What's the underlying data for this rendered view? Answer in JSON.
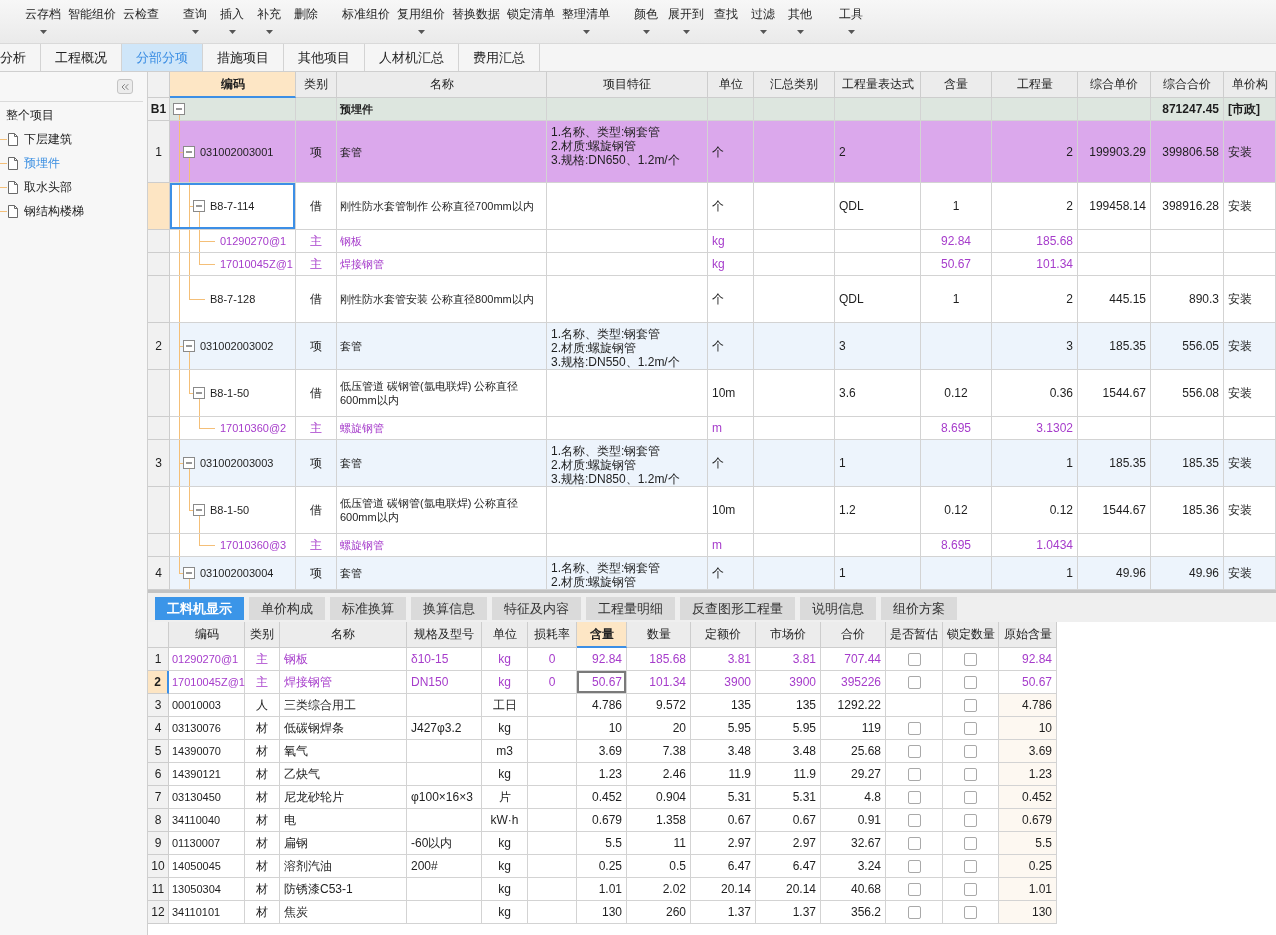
{
  "toolbar": {
    "groups": [
      [
        {
          "label": "云存档",
          "dropdown": true
        },
        {
          "label": "智能组价",
          "dropdown": false
        },
        {
          "label": "云检查",
          "dropdown": false
        }
      ],
      [
        {
          "label": "查询",
          "dropdown": true
        },
        {
          "label": "插入",
          "dropdown": true
        },
        {
          "label": "补充",
          "dropdown": true
        },
        {
          "label": "删除",
          "dropdown": false
        }
      ],
      [
        {
          "label": "标准组价",
          "dropdown": false
        },
        {
          "label": "复用组价",
          "dropdown": true
        },
        {
          "label": "替换数据",
          "dropdown": false
        },
        {
          "label": "锁定清单",
          "dropdown": false
        },
        {
          "label": "整理清单",
          "dropdown": true
        }
      ],
      [
        {
          "label": "颜色",
          "dropdown": true
        },
        {
          "label": "展开到",
          "dropdown": true
        },
        {
          "label": "查找",
          "dropdown": false
        },
        {
          "label": "过滤",
          "dropdown": true
        },
        {
          "label": "其他",
          "dropdown": true
        }
      ],
      [
        {
          "label": "工具",
          "dropdown": true
        }
      ]
    ]
  },
  "tabs": [
    {
      "label": "分析",
      "selected": false
    },
    {
      "label": "工程概况",
      "selected": false
    },
    {
      "label": "分部分项",
      "selected": true
    },
    {
      "label": "措施项目",
      "selected": false
    },
    {
      "label": "其他项目",
      "selected": false
    },
    {
      "label": "人材机汇总",
      "selected": false
    },
    {
      "label": "费用汇总",
      "selected": false
    }
  ],
  "sidebar": {
    "tree": [
      {
        "label": "整个项目",
        "selected": false,
        "children": [
          {
            "label": "下层建筑",
            "selected": false
          },
          {
            "label": "预埋件",
            "selected": true
          },
          {
            "label": "取水头部",
            "selected": false
          },
          {
            "label": "钢结构楼梯",
            "selected": false
          }
        ]
      }
    ]
  },
  "main_table": {
    "columns": [
      {
        "label": "编码",
        "selected": true
      },
      {
        "label": "类别",
        "selected": false
      },
      {
        "label": "名称",
        "selected": false
      },
      {
        "label": "项目特征",
        "selected": false
      },
      {
        "label": "单位",
        "selected": false
      },
      {
        "label": "汇总类别",
        "selected": false
      },
      {
        "label": "工程量表达式",
        "selected": false
      },
      {
        "label": "含量",
        "selected": false
      },
      {
        "label": "工程量",
        "selected": false
      },
      {
        "label": "综合单价",
        "selected": false
      },
      {
        "label": "综合合价",
        "selected": false
      },
      {
        "label": "单价构",
        "selected": false
      }
    ],
    "rows": [
      {
        "kind": "section",
        "number": "B1",
        "name": "预埋件",
        "total_price": "871247.45",
        "price_structure": "[市政]",
        "expanded": true,
        "selected": false,
        "children": [
          {
            "kind": "item",
            "number": "1",
            "code": "031002003001",
            "type": "项",
            "name": "套管",
            "features": "1.名称、类型:钢套管\n2.材质:螺旋钢管\n3.规格:DN650、1.2m/个",
            "unit": "个",
            "expression": "2",
            "quantity": "2",
            "unit_price": "199903.29",
            "total_price": "399806.58",
            "price_structure": "安装",
            "highlighted": true,
            "expanded": true,
            "selected": false,
            "children": [
              {
                "kind": "quota",
                "code": "B8-7-114",
                "type": "借",
                "name": "刚性防水套管制作 公称直径700mm以内",
                "unit": "个",
                "expression": "QDL",
                "content": "1",
                "quantity": "2",
                "unit_price": "199458.14",
                "total_price": "398916.28",
                "price_structure": "安装",
                "expanded": true,
                "selected": true,
                "children": [
                  {
                    "kind": "material",
                    "code": "01290270@1",
                    "type": "主",
                    "name": "钢板",
                    "unit": "kg",
                    "content": "92.84",
                    "quantity": "185.68",
                    "selected": false
                  },
                  {
                    "kind": "material",
                    "code": "17010045Z@1",
                    "type": "主",
                    "name": "焊接钢管",
                    "unit": "kg",
                    "content": "50.67",
                    "quantity": "101.34",
                    "selected": false
                  }
                ]
              },
              {
                "kind": "quota",
                "code": "B8-7-128",
                "type": "借",
                "name": "刚性防水套管安装 公称直径800mm以内",
                "unit": "个",
                "expression": "QDL",
                "content": "1",
                "quantity": "2",
                "unit_price": "445.15",
                "total_price": "890.3",
                "price_structure": "安装",
                "selected": false
              }
            ]
          },
          {
            "kind": "item",
            "number": "2",
            "code": "031002003002",
            "type": "项",
            "name": "套管",
            "features": "1.名称、类型:钢套管\n2.材质:螺旋钢管\n3.规格:DN550、1.2m/个",
            "unit": "个",
            "expression": "3",
            "quantity": "3",
            "unit_price": "185.35",
            "total_price": "556.05",
            "price_structure": "安装",
            "highlighted": false,
            "expanded": true,
            "selected": false,
            "children": [
              {
                "kind": "quota",
                "code": "B8-1-50",
                "type": "借",
                "name": "低压管道 碳钢管(氩电联焊) 公称直径600mm以内",
                "unit": "10m",
                "expression": "3.6",
                "content": "0.12",
                "quantity": "0.36",
                "unit_price": "1544.67",
                "total_price": "556.08",
                "price_structure": "安装",
                "expanded": true,
                "selected": false,
                "children": [
                  {
                    "kind": "material",
                    "code": "17010360@2",
                    "type": "主",
                    "name": "螺旋钢管",
                    "unit": "m",
                    "content": "8.695",
                    "quantity": "3.1302",
                    "selected": false
                  }
                ]
              }
            ]
          },
          {
            "kind": "item",
            "number": "3",
            "code": "031002003003",
            "type": "项",
            "name": "套管",
            "features": "1.名称、类型:钢套管\n2.材质:螺旋钢管\n3.规格:DN850、1.2m/个",
            "unit": "个",
            "expression": "1",
            "quantity": "1",
            "unit_price": "185.35",
            "total_price": "185.35",
            "price_structure": "安装",
            "highlighted": false,
            "expanded": true,
            "selected": false,
            "children": [
              {
                "kind": "quota",
                "code": "B8-1-50",
                "type": "借",
                "name": "低压管道 碳钢管(氩电联焊) 公称直径600mm以内",
                "unit": "10m",
                "expression": "1.2",
                "content": "0.12",
                "quantity": "0.12",
                "unit_price": "1544.67",
                "total_price": "185.36",
                "price_structure": "安装",
                "expanded": true,
                "selected": false,
                "children": [
                  {
                    "kind": "material",
                    "code": "17010360@3",
                    "type": "主",
                    "name": "螺旋钢管",
                    "unit": "m",
                    "content": "8.695",
                    "quantity": "1.0434",
                    "selected": false
                  }
                ]
              }
            ]
          },
          {
            "kind": "item",
            "number": "4",
            "code": "031002003004",
            "type": "项",
            "name": "套管",
            "features": "1.名称、类型:钢套管\n2.材质:螺旋钢管",
            "unit": "个",
            "expression": "1",
            "quantity": "1",
            "unit_price": "49.96",
            "total_price": "49.96",
            "price_structure": "安装",
            "highlighted": false,
            "expanded": true,
            "selected": false
          }
        ]
      }
    ]
  },
  "detail_tabs": [
    {
      "label": "工料机显示",
      "selected": true
    },
    {
      "label": "单价构成",
      "selected": false
    },
    {
      "label": "标准换算",
      "selected": false
    },
    {
      "label": "换算信息",
      "selected": false
    },
    {
      "label": "特征及内容",
      "selected": false
    },
    {
      "label": "工程量明细",
      "selected": false
    },
    {
      "label": "反查图形工程量",
      "selected": false
    },
    {
      "label": "说明信息",
      "selected": false
    },
    {
      "label": "组价方案",
      "selected": false
    }
  ],
  "detail_table": {
    "columns": [
      {
        "label": "编码",
        "selected": false
      },
      {
        "label": "类别",
        "selected": false
      },
      {
        "label": "名称",
        "selected": false
      },
      {
        "label": "规格及型号",
        "selected": false
      },
      {
        "label": "单位",
        "selected": false
      },
      {
        "label": "损耗率",
        "selected": false
      },
      {
        "label": "含量",
        "selected": true
      },
      {
        "label": "数量",
        "selected": false
      },
      {
        "label": "定额价",
        "selected": false
      },
      {
        "label": "市场价",
        "selected": false
      },
      {
        "label": "合价",
        "selected": false
      },
      {
        "label": "是否暂估",
        "selected": false
      },
      {
        "label": "锁定数量",
        "selected": false
      },
      {
        "label": "原始含量",
        "selected": false
      }
    ],
    "rows": [
      {
        "number": "1",
        "kind": "main",
        "code": "01290270@1",
        "type": "主",
        "name": "钢板",
        "spec": "δ10-15",
        "unit": "kg",
        "loss_rate": "0",
        "content": "92.84",
        "quantity": "185.68",
        "quota_price": "3.81",
        "market_price": "3.81",
        "total": "707.44",
        "provisional": false,
        "locked": false,
        "original_content": "92.84",
        "selected": false
      },
      {
        "number": "2",
        "kind": "main",
        "code": "17010045Z@1",
        "type": "主",
        "name": "焊接钢管",
        "spec": "DN150",
        "unit": "kg",
        "loss_rate": "0",
        "content": "50.67",
        "quantity": "101.34",
        "quota_price": "3900",
        "market_price": "3900",
        "total": "395226",
        "provisional": false,
        "locked": false,
        "original_content": "50.67",
        "selected": true
      },
      {
        "number": "3",
        "kind": "labor",
        "code": "00010003",
        "type": "人",
        "name": "三类综合用工",
        "unit": "工日",
        "content": "4.786",
        "quantity": "9.572",
        "quota_price": "135",
        "market_price": "135",
        "total": "1292.22",
        "locked": false,
        "original_content": "4.786",
        "selected": false
      },
      {
        "number": "4",
        "kind": "material",
        "code": "03130076",
        "type": "材",
        "name": "低碳钢焊条",
        "spec": "J427φ3.2",
        "unit": "kg",
        "content": "10",
        "quantity": "20",
        "quota_price": "5.95",
        "market_price": "5.95",
        "total": "119",
        "provisional": false,
        "locked": false,
        "original_content": "10",
        "selected": false
      },
      {
        "number": "5",
        "kind": "material",
        "code": "14390070",
        "type": "材",
        "name": "氧气",
        "unit": "m3",
        "content": "3.69",
        "quantity": "7.38",
        "quota_price": "3.48",
        "market_price": "3.48",
        "total": "25.68",
        "provisional": false,
        "locked": false,
        "original_content": "3.69",
        "selected": false
      },
      {
        "number": "6",
        "kind": "material",
        "code": "14390121",
        "type": "材",
        "name": "乙炔气",
        "unit": "kg",
        "content": "1.23",
        "quantity": "2.46",
        "quota_price": "11.9",
        "market_price": "11.9",
        "total": "29.27",
        "provisional": false,
        "locked": false,
        "original_content": "1.23",
        "selected": false
      },
      {
        "number": "7",
        "kind": "material",
        "code": "03130450",
        "type": "材",
        "name": "尼龙砂轮片",
        "spec": "φ100×16×3",
        "unit": "片",
        "content": "0.452",
        "quantity": "0.904",
        "quota_price": "5.31",
        "market_price": "5.31",
        "total": "4.8",
        "provisional": false,
        "locked": false,
        "original_content": "0.452",
        "selected": false
      },
      {
        "number": "8",
        "kind": "material",
        "code": "34110040",
        "type": "材",
        "name": "电",
        "unit": "kW·h",
        "content": "0.679",
        "quantity": "1.358",
        "quota_price": "0.67",
        "market_price": "0.67",
        "total": "0.91",
        "provisional": false,
        "locked": false,
        "original_content": "0.679",
        "selected": false
      },
      {
        "number": "9",
        "kind": "material",
        "code": "01130007",
        "type": "材",
        "name": "扁钢",
        "spec": "-60以内",
        "unit": "kg",
        "content": "5.5",
        "quantity": "11",
        "quota_price": "2.97",
        "market_price": "2.97",
        "total": "32.67",
        "provisional": false,
        "locked": false,
        "original_content": "5.5",
        "selected": false
      },
      {
        "number": "10",
        "kind": "material",
        "code": "14050045",
        "type": "材",
        "name": "溶剂汽油",
        "spec": "200#",
        "unit": "kg",
        "content": "0.25",
        "quantity": "0.5",
        "quota_price": "6.47",
        "market_price": "6.47",
        "total": "3.24",
        "provisional": false,
        "locked": false,
        "original_content": "0.25",
        "selected": false
      },
      {
        "number": "11",
        "kind": "material",
        "code": "13050304",
        "type": "材",
        "name": "防锈漆C53-1",
        "unit": "kg",
        "content": "1.01",
        "quantity": "2.02",
        "quota_price": "20.14",
        "market_price": "20.14",
        "total": "40.68",
        "provisional": false,
        "locked": false,
        "original_content": "1.01",
        "selected": false
      },
      {
        "number": "12",
        "kind": "material",
        "code": "34110101",
        "type": "材",
        "name": "焦炭",
        "unit": "kg",
        "content": "130",
        "quantity": "260",
        "quota_price": "1.37",
        "market_price": "1.37",
        "total": "356.2",
        "provisional": false,
        "locked": false,
        "original_content": "130",
        "selected": false
      }
    ]
  }
}
